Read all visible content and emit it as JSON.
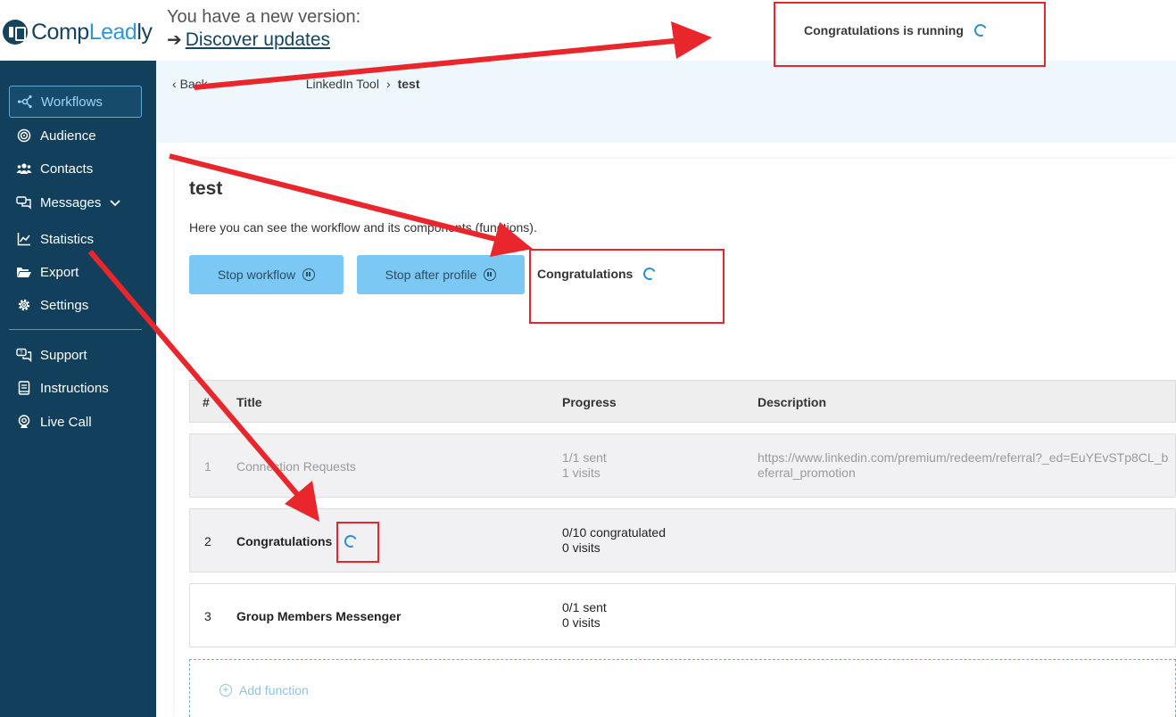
{
  "brand": {
    "name_a": "Comp",
    "name_b": "Lead",
    "name_c": "ly"
  },
  "update": {
    "notice": "You have a new version:",
    "arrow": "➔",
    "link": "Discover updates"
  },
  "header": {
    "running_text": "Congratulations is running"
  },
  "sidebar": {
    "items": [
      {
        "label": "Workflows",
        "icon": "workflow-icon"
      },
      {
        "label": "Audience",
        "icon": "target-icon"
      },
      {
        "label": "Contacts",
        "icon": "users-icon"
      },
      {
        "label": "Messages",
        "icon": "chat-icon"
      },
      {
        "label": "Statistics",
        "icon": "chart-icon"
      },
      {
        "label": "Export",
        "icon": "folder-icon"
      },
      {
        "label": "Settings",
        "icon": "gear-icon"
      },
      {
        "label": "Support",
        "icon": "support-icon"
      },
      {
        "label": "Instructions",
        "icon": "book-icon"
      },
      {
        "label": "Live Call",
        "icon": "webcam-icon"
      }
    ]
  },
  "breadcrumb": {
    "back": "Back",
    "parent": "LinkedIn Tool",
    "separator": "›",
    "current": "test"
  },
  "workflow": {
    "title": "test",
    "description": "Here you can see the workflow and its components (functions).",
    "stop_button": "Stop workflow",
    "stop_after_button": "Stop after profile",
    "status_label": "Congratulations"
  },
  "table": {
    "headers": {
      "num": "#",
      "title": "Title",
      "progress": "Progress",
      "description": "Description"
    },
    "rows": [
      {
        "num": "1",
        "title": "Connection Requests",
        "progress_1": "1/1 sent",
        "progress_2": "1 visits",
        "desc_1": "https://www.linkedin.com/premium/redeem/referral?_ed=EuYEvSTp8CL_b",
        "desc_2": "eferral_promotion"
      },
      {
        "num": "2",
        "title": "Congratulations",
        "progress_1": "0/10 congratulated",
        "progress_2": "0 visits",
        "desc_1": "",
        "desc_2": ""
      },
      {
        "num": "3",
        "title": "Group Members Messenger",
        "progress_1": "0/1 sent",
        "progress_2": "0 visits",
        "desc_1": "",
        "desc_2": ""
      }
    ]
  },
  "add_function": {
    "label": "Add function"
  },
  "colors": {
    "sidebar": "#123f5b",
    "accent": "#2b9ad6",
    "button": "#7cc8f4",
    "annotation": "#e8262b"
  }
}
